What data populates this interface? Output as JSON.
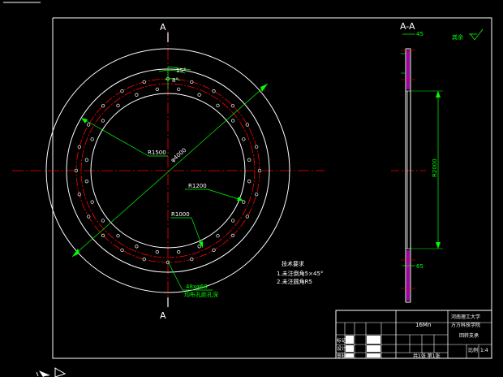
{
  "drawing": {
    "section_mark_top": "A",
    "section_mark_bottom": "A",
    "section_view_title": "A-A",
    "dimensions": {
      "angle_outer": "15°",
      "angle_inner": "8°",
      "radius_outer": "R1500",
      "radius_mid": "R1200",
      "radius_inner": "R1000",
      "pitch_diameter": "φ4000",
      "hole_callout_line1": "48xφ68",
      "hole_callout_line2": "均布孔距孔深"
    },
    "notes": {
      "title": "技术要求",
      "line1": "1.未注倒角5×45°",
      "line2": "2.未注圆角R5"
    },
    "surface_finish": "其余",
    "section_dims": {
      "top_width": "45",
      "bottom_width": "65",
      "height": "R2000"
    }
  },
  "title_block": {
    "material": "16Mn",
    "institution_line1": "河南理工大学",
    "institution_line2": "万方科技学院",
    "drawing_name": "回转支承",
    "left_label_1": "标记",
    "left_label_2": "设计",
    "left_label_3": "审核",
    "right_label_scale": "比例",
    "right_scale_value": "1:4",
    "sheet_label": "共1张 第1张"
  },
  "colors": {
    "background": "#000000",
    "line": "#ffffff",
    "centerline": "#ff0000",
    "dimension": "#00ff00",
    "hatch": "#ff00ff"
  }
}
